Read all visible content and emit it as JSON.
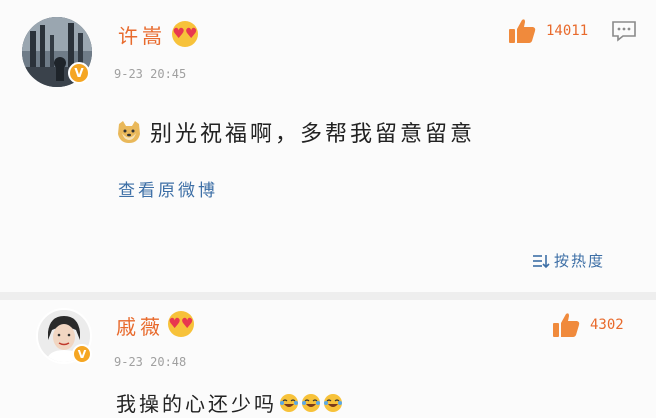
{
  "comments": [
    {
      "username": "许嵩",
      "timestamp": "9-23 20:45",
      "likes": "14011",
      "text": "别光祝福啊，多帮我留意留意",
      "emoji_prefix": "doge-icon"
    },
    {
      "username": "戚薇",
      "timestamp": "9-23 20:48",
      "likes": "4302",
      "text": "我操的心还少吗",
      "emoji_suffix": [
        "laugh-cry-icon",
        "laugh-cry-icon",
        "laugh-cry-icon"
      ]
    }
  ],
  "view_original_label": "查看原微博",
  "sort_label": "按热度",
  "colors": {
    "username": "#e86a2c",
    "link": "#3d6fa6",
    "timestamp": "#a0a0a0",
    "verified": "#f5a623"
  }
}
